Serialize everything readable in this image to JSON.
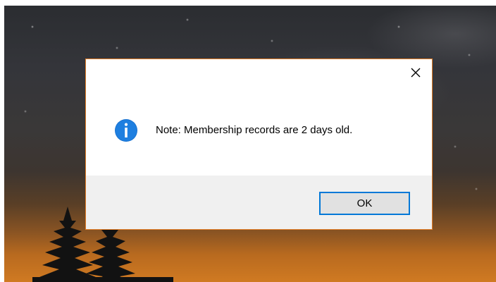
{
  "dialog": {
    "message": "Note: Membership records are 2 days old.",
    "ok_label": "OK",
    "icon": "info-icon",
    "close_icon": "close-icon"
  },
  "colors": {
    "accent": "#0078d7",
    "dialog_border": "#e07a24",
    "footer_bg": "#f0f0f0"
  }
}
